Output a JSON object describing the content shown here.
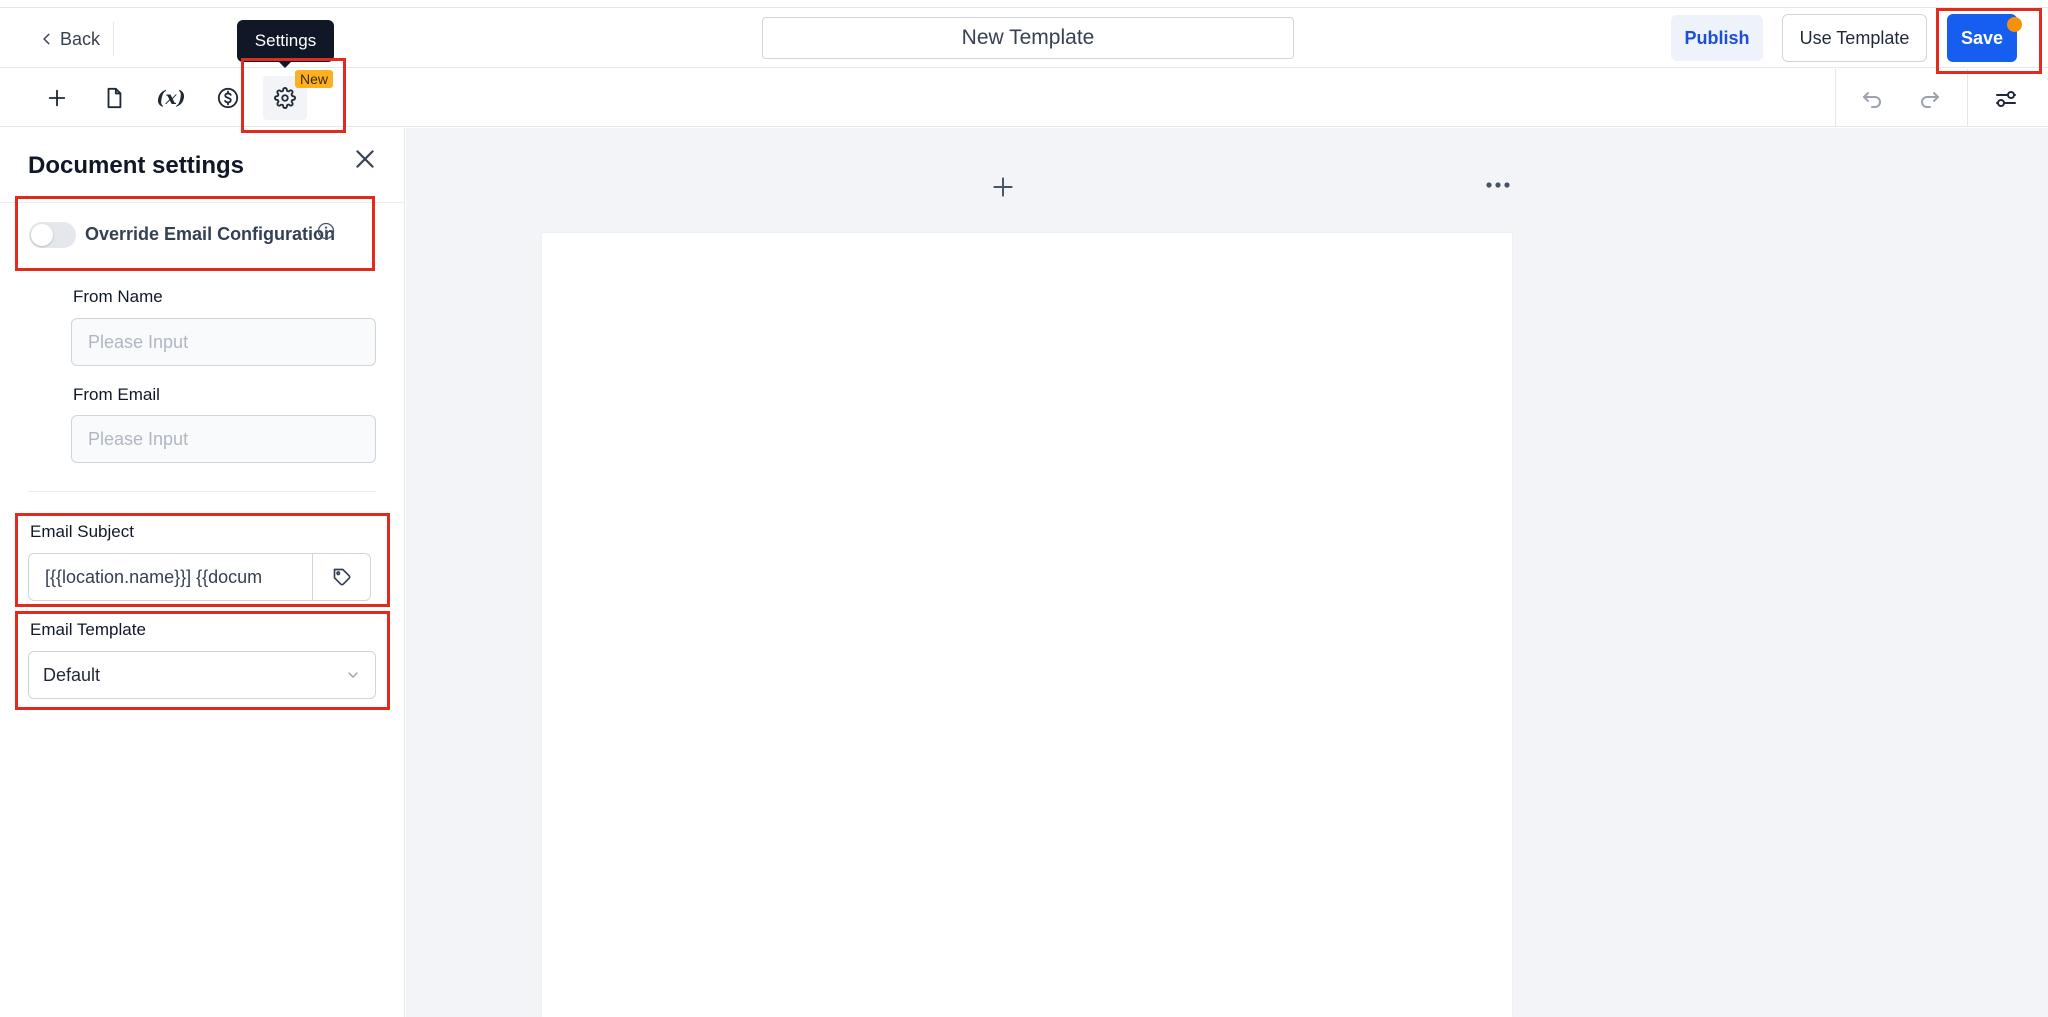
{
  "header": {
    "back_label": "Back",
    "title": "New Template",
    "publish_label": "Publish",
    "use_template_label": "Use Template",
    "save_label": "Save"
  },
  "toolbar": {
    "tools": [
      {
        "name": "add",
        "icon": "plus-icon"
      },
      {
        "name": "pages",
        "icon": "document-icon"
      },
      {
        "name": "variables",
        "icon": "variable-icon",
        "glyph": "(x)"
      },
      {
        "name": "pricing",
        "icon": "dollar-icon"
      },
      {
        "name": "settings",
        "icon": "gear-icon",
        "active": true
      }
    ],
    "badge": "New",
    "tooltip": "Settings"
  },
  "panel": {
    "title": "Document settings",
    "override_label": "Override Email Configuration",
    "override_enabled": false,
    "from_name_label": "From Name",
    "from_name_placeholder": "Please Input",
    "from_email_label": "From Email",
    "from_email_placeholder": "Please Input",
    "email_subject_label": "Email Subject",
    "email_subject_value": "[{{location.name}}] {{docum",
    "email_template_label": "Email Template",
    "email_template_value": "Default"
  },
  "colors": {
    "primary": "#155eef",
    "badge": "#fdb022",
    "notification_dot": "#f79009",
    "highlight": "#e32b1d"
  }
}
